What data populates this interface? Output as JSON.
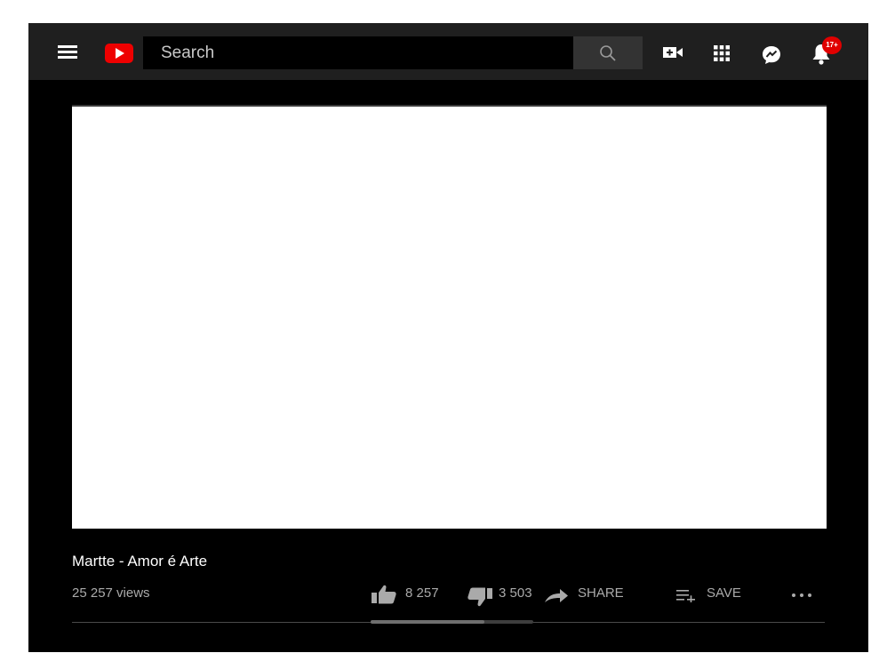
{
  "header": {
    "menu_icon": "hamburger-menu-icon",
    "logo_icon": "youtube-logo-icon",
    "search": {
      "placeholder": "Search",
      "value": ""
    },
    "icons": [
      "search-icon",
      "create-video-icon",
      "apps-grid-icon",
      "messages-icon",
      "notifications-bell-icon"
    ],
    "notification_badge": "17+",
    "accent_color": "#ee0000"
  },
  "video": {
    "title": "Martte - Amor é Arte",
    "views": "25 257 views",
    "likes": "8 257",
    "dislikes": "3 503",
    "like_ratio": 0.702,
    "share_label": "SHARE",
    "save_label": "SAVE",
    "more_icon": "more-options-icon"
  }
}
